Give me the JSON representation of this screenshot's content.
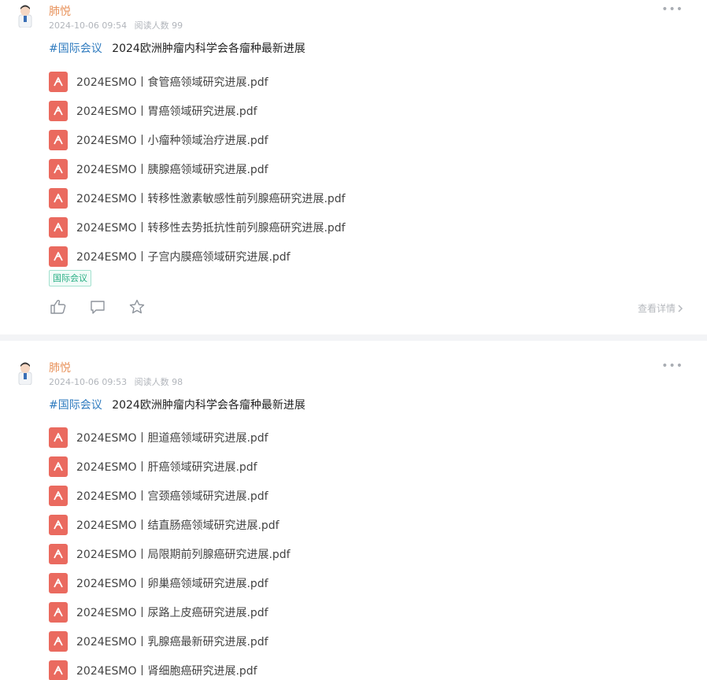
{
  "posts": [
    {
      "author": "肺悦",
      "date": "2024-10-06 09:54",
      "reads_label": "阅读人数",
      "reads": "99",
      "hashtag": "#国际会议",
      "title": "2024欧洲肿瘤内科学会各瘤种最新进展",
      "files": [
        "2024ESMO丨食管癌领域研究进展.pdf",
        "2024ESMO丨胃癌领域研究进展.pdf",
        "2024ESMO丨小瘤种领域治疗进展.pdf",
        "2024ESMO丨胰腺癌领域研究进展.pdf",
        "2024ESMO丨转移性激素敏感性前列腺癌研究进展.pdf",
        "2024ESMO丨转移性去势抵抗性前列腺癌研究进展.pdf",
        "2024ESMO丨子宫内膜癌领域研究进展.pdf"
      ],
      "tag": "国际会议",
      "details_label": "查看详情"
    },
    {
      "author": "肺悦",
      "date": "2024-10-06 09:53",
      "reads_label": "阅读人数",
      "reads": "98",
      "hashtag": "#国际会议",
      "title": "2024欧洲肿瘤内科学会各瘤种最新进展",
      "files": [
        "2024ESMO丨胆道癌领域研究进展.pdf",
        "2024ESMO丨肝癌领域研究进展.pdf",
        "2024ESMO丨宫颈癌领域研究进展.pdf",
        "2024ESMO丨结直肠癌领域研究进展.pdf",
        "2024ESMO丨局限期前列腺癌研究进展.pdf",
        "2024ESMO丨卵巢癌领域研究进展.pdf",
        "2024ESMO丨尿路上皮癌研究进展.pdf",
        "2024ESMO丨乳腺癌最新研究进展.pdf",
        "2024ESMO丨肾细胞癌研究进展.pdf"
      ]
    }
  ],
  "icons": {
    "more": "more-dots-icon",
    "file": "pdf-icon",
    "like": "thumbs-up-icon",
    "comment": "comment-icon",
    "favorite": "star-icon",
    "chevron": "chevron-right-icon"
  },
  "colors": {
    "author": "#e8935c",
    "hashtag": "#2f7bbf",
    "pdf": "#ea6a5f",
    "tag": "#27ae83"
  }
}
